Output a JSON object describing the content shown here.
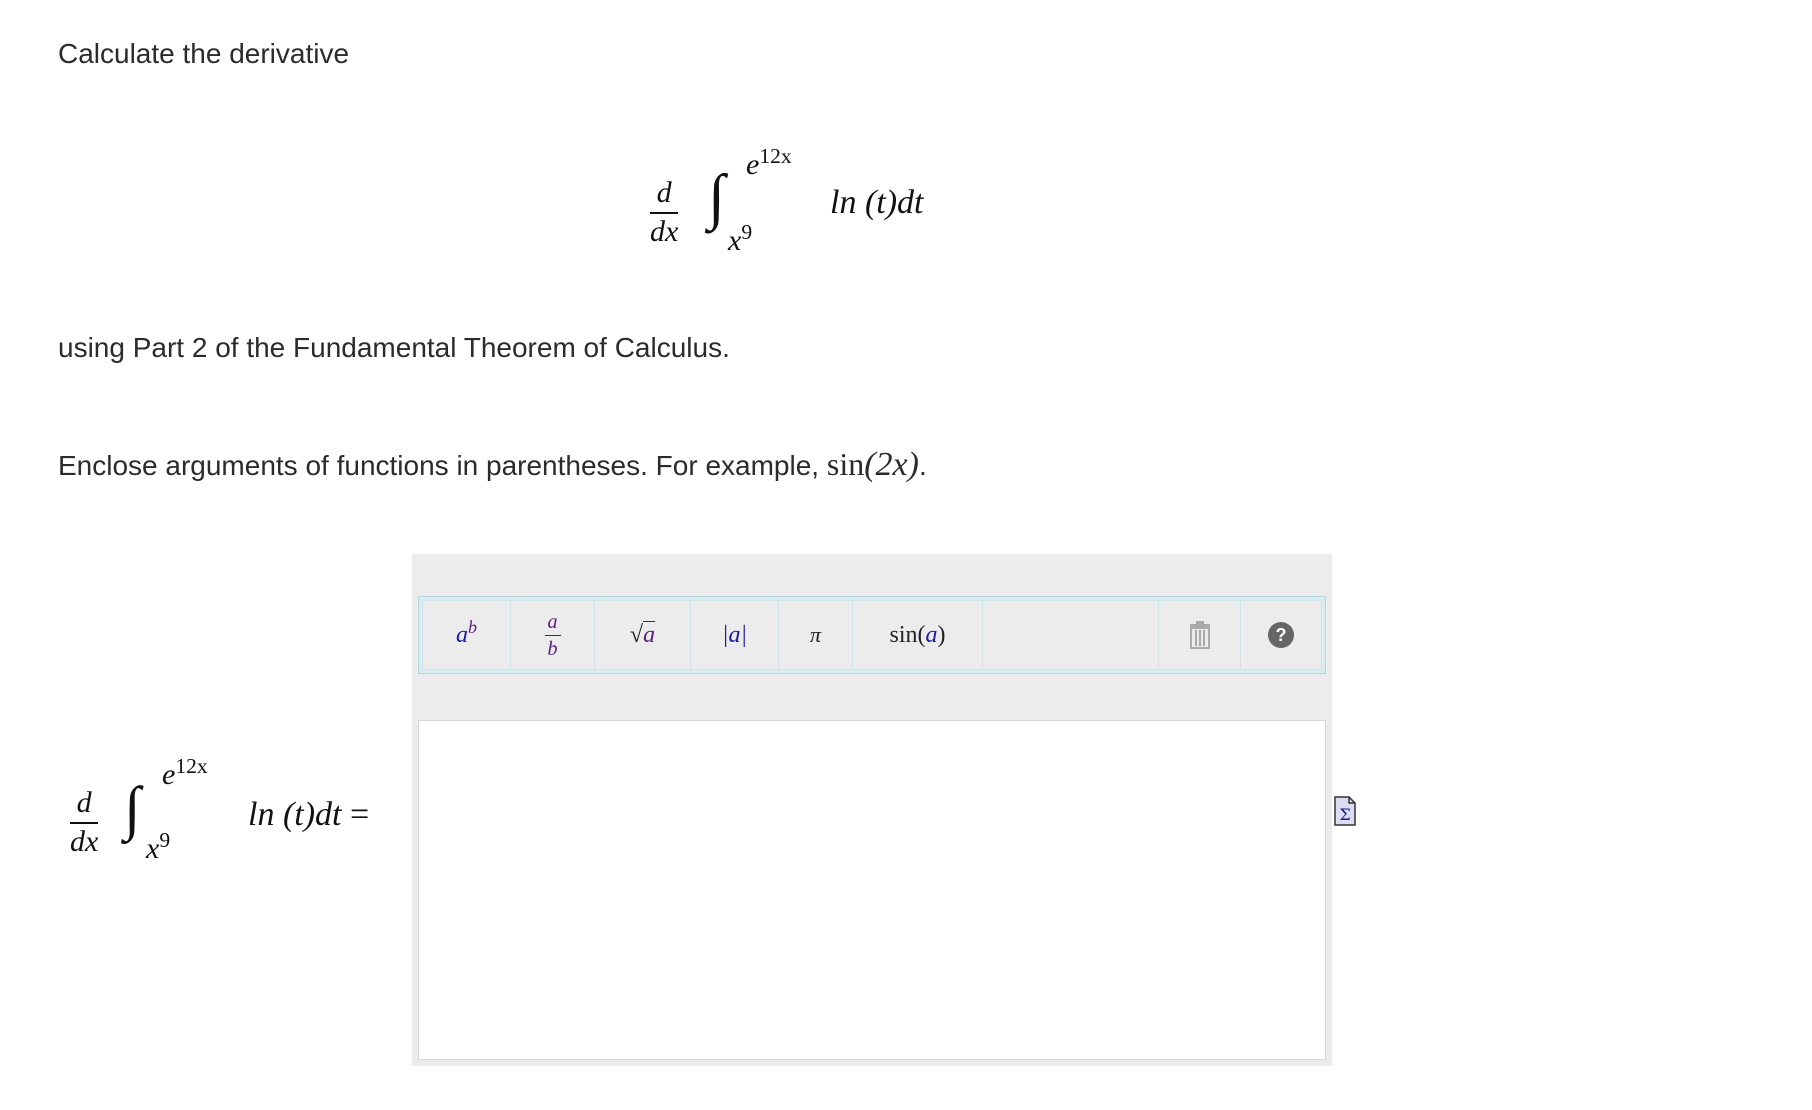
{
  "question": {
    "intro": "Calculate the derivative",
    "method": "using Part 2 of the Fundamental Theorem of Calculus.",
    "instruction_prefix": "Enclose arguments of functions in parentheses. For example, ",
    "example_func": "sin",
    "example_arg": "(2x)",
    "instruction_suffix": "."
  },
  "expression": {
    "deriv_num": "d",
    "deriv_den": "dx",
    "integral_sign": "∫",
    "upper_base": "e",
    "upper_exp": "12x",
    "lower_base": "x",
    "lower_exp": "9",
    "integrand": "ln (t)dt",
    "equals": "="
  },
  "toolbar": {
    "power": {
      "base": "a",
      "exp": "b"
    },
    "fraction": {
      "num": "a",
      "den": "b"
    },
    "sqrt": {
      "radical": "√",
      "arg": "a"
    },
    "abs": "|a|",
    "pi": "π",
    "sin": {
      "func": "sin ",
      "arg": "a"
    },
    "delete_icon": "trash-icon",
    "help_icon": "help-icon"
  },
  "answer": {
    "value": ""
  },
  "icons": {
    "sigma": "sigma-icon"
  },
  "colors": {
    "toolbar_border": "#b7d3db",
    "editor_bg": "#ececec",
    "var_blue": "#1a1aa6",
    "var_purple": "#5a1f7a"
  }
}
